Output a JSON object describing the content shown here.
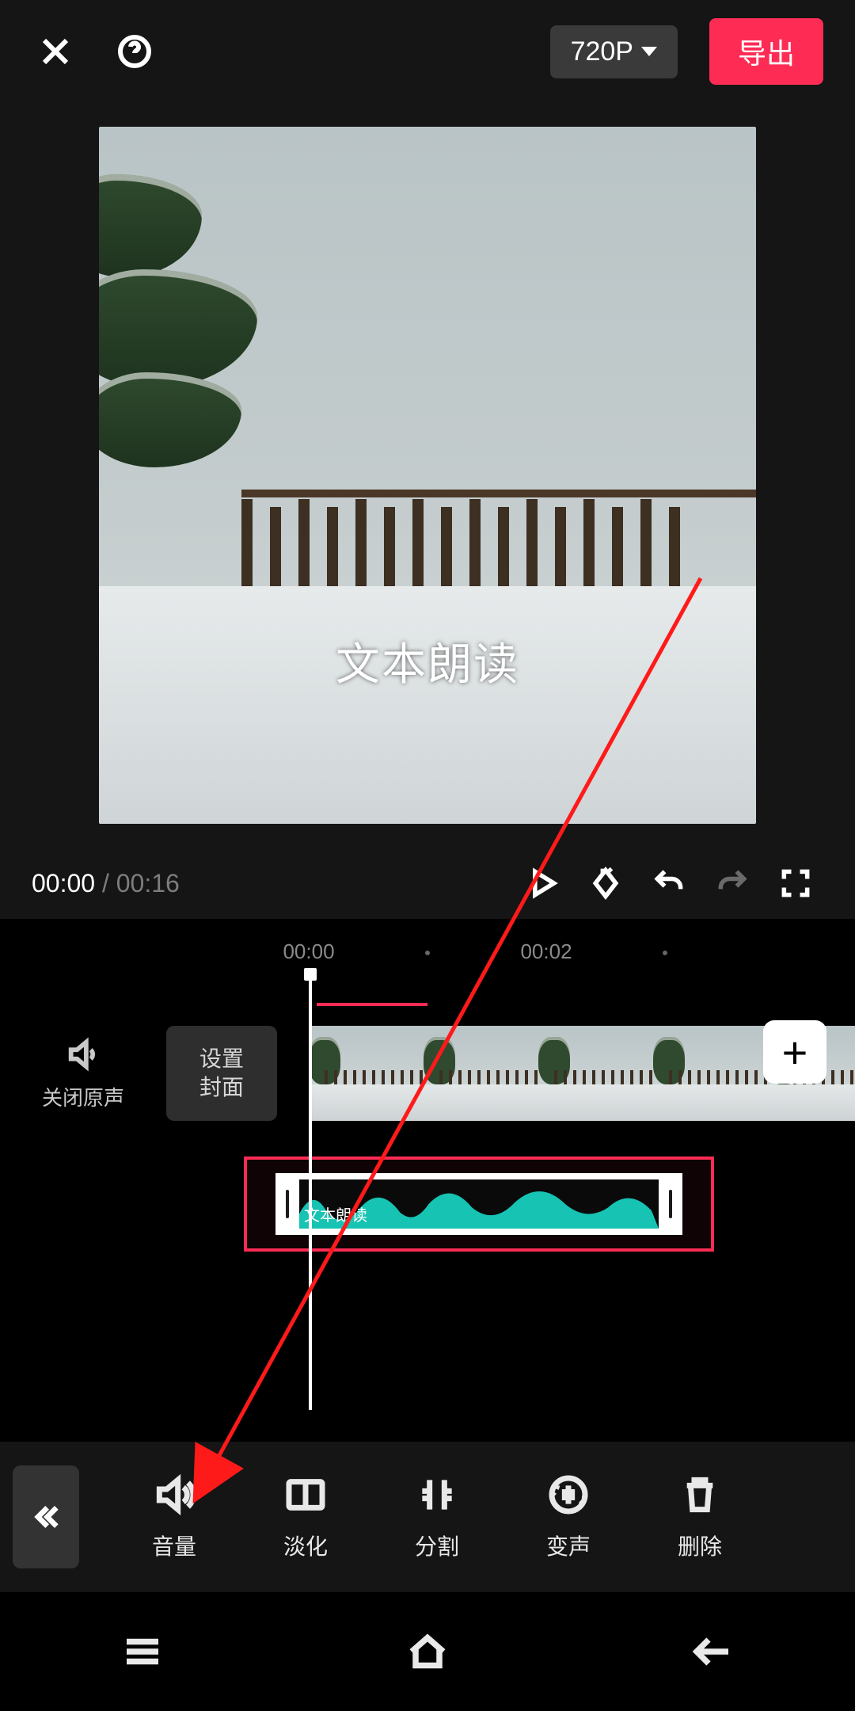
{
  "topbar": {
    "resolution_label": "720P",
    "export_label": "导出"
  },
  "preview": {
    "overlay_text": "文本朗读"
  },
  "transport": {
    "current_time": "00:00",
    "duration": "00:16",
    "separator": " / "
  },
  "timeline": {
    "ruler": [
      "00:00",
      "00:02"
    ],
    "mute_original_label": "关闭原声",
    "cover_button_label": "设置\n封面",
    "audio_clip_label": "文本朗读",
    "add_label": "+"
  },
  "toolbar": {
    "items": [
      {
        "label": "音量",
        "icon": "volume-icon"
      },
      {
        "label": "淡化",
        "icon": "fade-icon"
      },
      {
        "label": "分割",
        "icon": "split-icon"
      },
      {
        "label": "变声",
        "icon": "voice-change-icon"
      },
      {
        "label": "删除",
        "icon": "delete-icon"
      }
    ]
  },
  "colors": {
    "accent": "#fe2c55",
    "waveform": "#17c3b2"
  }
}
